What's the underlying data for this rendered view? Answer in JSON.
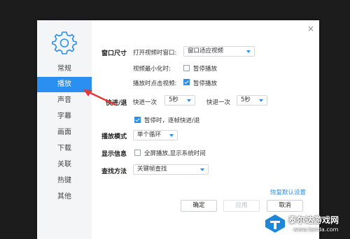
{
  "sidebar": {
    "items": [
      {
        "label": "常规"
      },
      {
        "label": "播放",
        "active": true
      },
      {
        "label": "声音"
      },
      {
        "label": "字幕"
      },
      {
        "label": "画面"
      },
      {
        "label": "下载"
      },
      {
        "label": "关联"
      },
      {
        "label": "热键"
      },
      {
        "label": "其他"
      }
    ]
  },
  "window_size": {
    "label": "窗口尺寸",
    "open_label": "打开视频时窗口:",
    "open_value": "窗口适应视频",
    "minimize_label": "视频最小化时:",
    "minimize_option": "暂停播放",
    "minimize_checked": false,
    "click_label": "播放时点击视频:",
    "click_option": "暂停播放",
    "click_checked": true
  },
  "seek": {
    "label": "快进/退",
    "forward_label": "快进一次",
    "forward_value": "5秒",
    "back_label": "快退一次",
    "back_value": "5秒",
    "frame_option": "暂停时，逐帧快进/退",
    "frame_checked": true
  },
  "play_mode": {
    "label": "播放模式",
    "value": "单个循环"
  },
  "display_info": {
    "label": "显示信息",
    "option": "全屏播放,显示系统时间",
    "checked": false
  },
  "find_method": {
    "label": "查找方法",
    "value": "关键帧查找"
  },
  "restore_defaults": "恢复默认设置",
  "buttons": {
    "ok": "确定",
    "apply": "应用",
    "cancel": "取消"
  },
  "watermark": {
    "text": "泰尔达游戏网",
    "url": "www.tairda.com"
  },
  "colors": {
    "accent": "#2a8ff0",
    "annotation": "#e53935"
  }
}
